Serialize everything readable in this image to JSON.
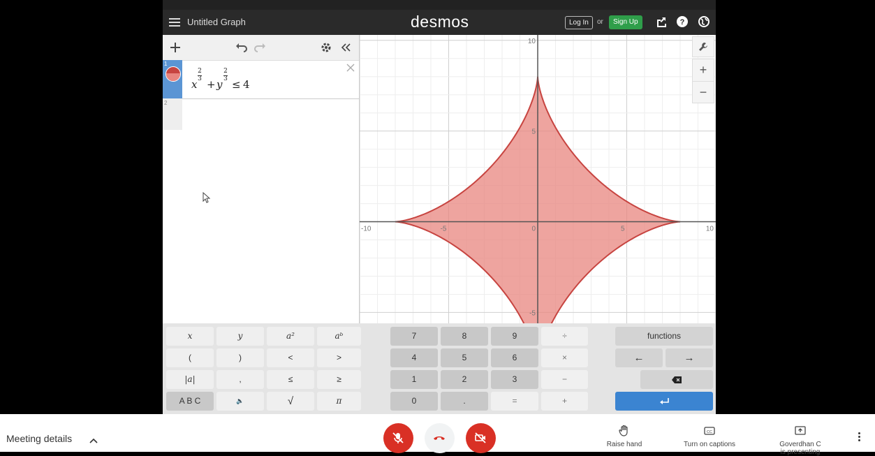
{
  "header": {
    "menu_icon": "hamburger-icon",
    "graph_title": "Untitled Graph",
    "brand": "desmos",
    "login_label": "Log In",
    "or_text": "or",
    "signup_label": "Sign Up",
    "icons": [
      "share-icon",
      "help-icon",
      "globe-icon"
    ]
  },
  "expression_panel": {
    "toolbar_icons": [
      "add-icon",
      "undo-icon",
      "redo-icon",
      "settings-icon",
      "collapse-icon"
    ],
    "expressions": [
      {
        "index": "1",
        "latex": "x^{\\frac{2}{3}}+y^{\\frac{2}{3}}\\le4",
        "base_x": "x",
        "plus": "+",
        "base_y": "y",
        "exp_num": "2",
        "exp_den": "3",
        "relation": "≤",
        "rhs": "4",
        "color": "#c74440"
      }
    ],
    "empty_row_index": "2"
  },
  "graph": {
    "x_ticks": [
      "-10",
      "-5",
      "0",
      "5",
      "10"
    ],
    "y_ticks": [
      "10",
      "5",
      "-5"
    ],
    "xlim": [
      -10,
      10
    ],
    "ylim": [
      -5.6,
      10.3
    ],
    "region_color": "#e8857f",
    "boundary_color": "#c74440",
    "zoom_in": "+",
    "zoom_out": "−",
    "wrench_icon": "wrench-icon"
  },
  "keypad": {
    "left": [
      "x",
      "y",
      "a²",
      "aᵇ",
      "(",
      ")",
      "<",
      ">",
      "|a|",
      ",",
      "≤",
      "≥",
      "A B C",
      "🔈",
      "√",
      "π"
    ],
    "middle": [
      "7",
      "8",
      "9",
      "÷",
      "4",
      "5",
      "6",
      "×",
      "1",
      "2",
      "3",
      "−",
      "0",
      ".",
      "=",
      "+"
    ],
    "functions_label": "functions",
    "arrow_left": "←",
    "arrow_right": "→",
    "backspace_icon": "backspace-icon",
    "enter_icon": "enter-icon"
  },
  "meeting": {
    "details_label": "Meeting details",
    "raise_hand_label": "Raise hand",
    "captions_label": "Turn on captions",
    "presenter_line1": "Goverdhan C",
    "presenter_line2": "is presenting",
    "mic_state": "muted",
    "camera_state": "off",
    "accent": "#d93025"
  }
}
